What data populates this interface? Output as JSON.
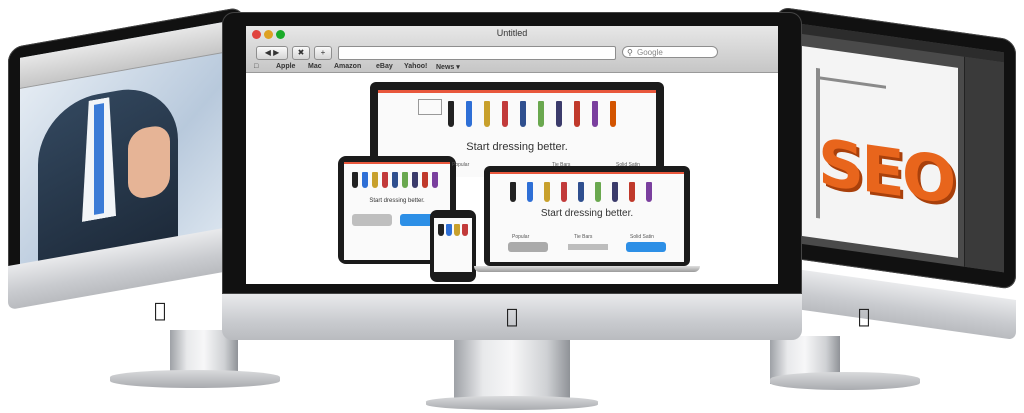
{
  "browser": {
    "window_title": "Untitled",
    "search_placeholder": "Google",
    "bookmarks": [
      "Apple",
      "Mac",
      "Amazon",
      "eBay",
      "Yahoo!",
      "News ▾"
    ]
  },
  "website": {
    "tagline": "Start dressing better.",
    "categories": [
      "Popular",
      "Tie Bars",
      "Solid Satin"
    ]
  },
  "colors": {
    "accent": "#e8573c",
    "tie_colors": [
      "#222222",
      "#2e6fd6",
      "#c8a02c",
      "#c23a3a",
      "#2f4f8f",
      "#6aa84f",
      "#3b3b6b",
      "#c0392b",
      "#7a3f9e",
      "#d35400"
    ]
  },
  "icons": [
    "apple-logo-icon",
    "back-forward-icon",
    "reader-icon",
    "add-tab-icon",
    "search-icon"
  ]
}
